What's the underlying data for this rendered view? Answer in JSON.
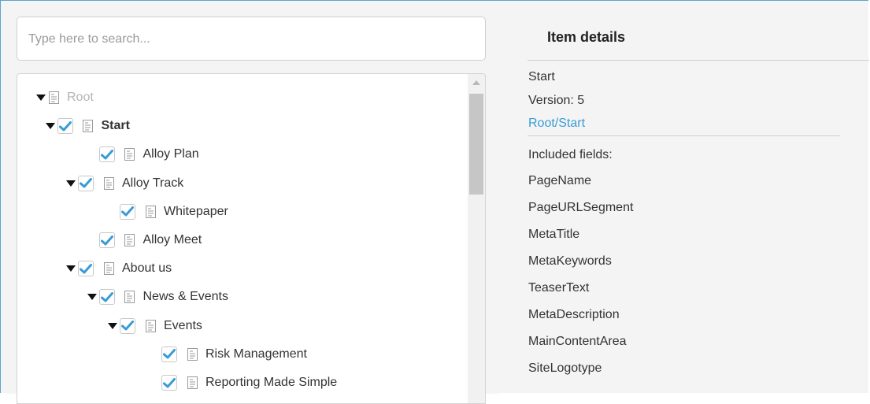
{
  "search": {
    "placeholder": "Type here to search..."
  },
  "tree": {
    "items": [
      {
        "label": "Root",
        "expanded": true,
        "checkbox": false,
        "checked": false,
        "style": "muted"
      },
      {
        "label": "Start",
        "expanded": true,
        "checkbox": true,
        "checked": true,
        "style": "bold"
      },
      {
        "label": "Alloy Plan",
        "expanded": false,
        "checkbox": true,
        "checked": true,
        "style": "normal"
      },
      {
        "label": "Alloy Track",
        "expanded": true,
        "checkbox": true,
        "checked": true,
        "style": "normal"
      },
      {
        "label": "Whitepaper",
        "expanded": false,
        "checkbox": true,
        "checked": true,
        "style": "normal"
      },
      {
        "label": "Alloy Meet",
        "expanded": false,
        "checkbox": true,
        "checked": true,
        "style": "normal"
      },
      {
        "label": "About us",
        "expanded": true,
        "checkbox": true,
        "checked": true,
        "style": "normal"
      },
      {
        "label": "News & Events",
        "expanded": true,
        "checkbox": true,
        "checked": true,
        "style": "normal"
      },
      {
        "label": "Events",
        "expanded": true,
        "checkbox": true,
        "checked": true,
        "style": "normal"
      },
      {
        "label": "Risk Management",
        "expanded": false,
        "checkbox": true,
        "checked": true,
        "style": "normal"
      },
      {
        "label": "Reporting Made Simple",
        "expanded": false,
        "checkbox": true,
        "checked": true,
        "style": "normal"
      }
    ]
  },
  "details": {
    "title": "Item details",
    "name": "Start",
    "version": "Version: 5",
    "path": "Root/Start",
    "fields_label": "Included fields:",
    "fields": [
      "PageName",
      "PageURLSegment",
      "MetaTitle",
      "MetaKeywords",
      "TeaserText",
      "MetaDescription",
      "MainContentArea",
      "SiteLogotype"
    ]
  },
  "colors": {
    "accent": "#3a9bd5",
    "check": "#3a9bd5",
    "frame": "#5aa6c4"
  },
  "icons": {
    "expand": "caret-down-icon",
    "page": "document-icon",
    "check": "checkmark-icon"
  }
}
